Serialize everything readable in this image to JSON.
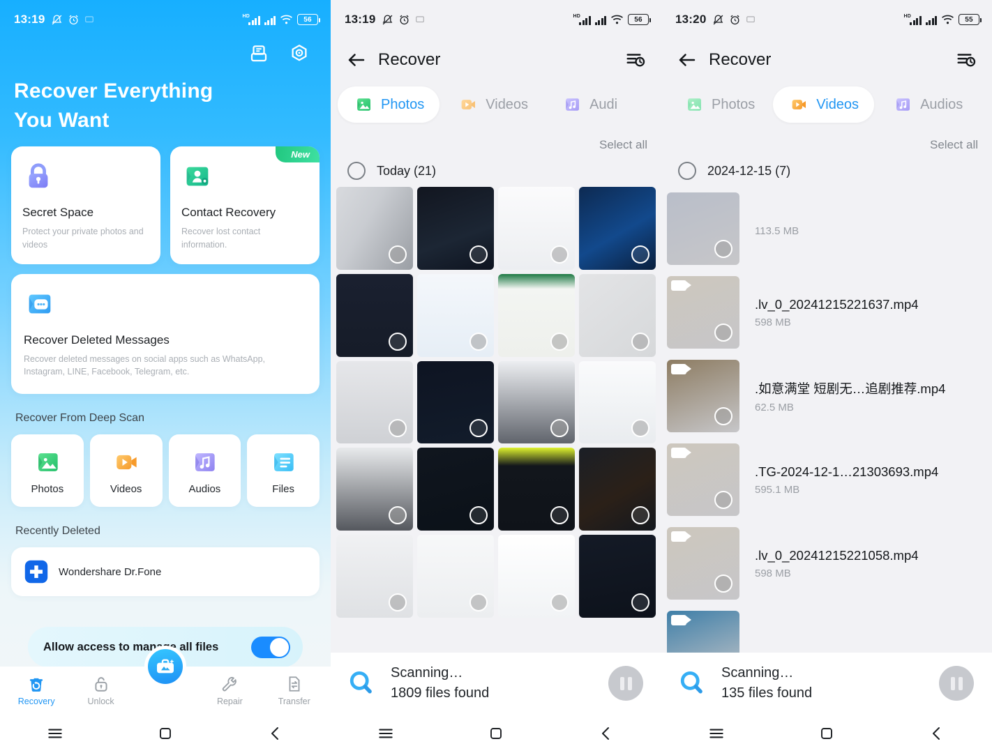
{
  "panel1": {
    "status": {
      "time": "13:19",
      "battery": "56",
      "hd_label": "HD",
      "icons": [
        "mute-icon",
        "alarm-icon",
        "cast-icon"
      ]
    },
    "header_icons": [
      {
        "name": "archive-icon"
      },
      {
        "name": "settings-hex-icon"
      }
    ],
    "hero": {
      "line1": "Recover Everything",
      "line2": "You Want"
    },
    "cards": [
      {
        "icon": "lock-icon",
        "title": "Secret Space",
        "desc": "Protect your private photos and videos",
        "badge": ""
      },
      {
        "icon": "contact-icon",
        "title": "Contact Recovery",
        "desc": "Recover lost contact information.",
        "badge": "New"
      }
    ],
    "wide_card": {
      "icon": "message-bubble-icon",
      "title": "Recover Deleted Messages",
      "desc": "Recover deleted messages on social apps such as WhatsApp, Instagram, LINE, Facebook, Telegram, etc."
    },
    "deep_scan": {
      "section_title": "Recover From Deep Scan",
      "tiles": [
        {
          "label": "Photos",
          "icon": "photos-icon"
        },
        {
          "label": "Videos",
          "icon": "videos-icon"
        },
        {
          "label": "Audios",
          "icon": "audios-icon"
        },
        {
          "label": "Files",
          "icon": "files-icon"
        }
      ]
    },
    "recently_deleted": {
      "section_title": "Recently Deleted",
      "app_name": "Wondershare Dr.Fone",
      "app_icon": "drfone-plus-icon"
    },
    "allow_banner": {
      "text": "Allow access to manage all files",
      "toggle_on": true
    },
    "tabbar": [
      {
        "label": "Recovery",
        "icon": "trash-restore-icon",
        "active": true
      },
      {
        "label": "Unlock",
        "icon": "unlock-icon",
        "active": false
      },
      {
        "label": "Repair",
        "icon": "wrench-icon",
        "active": false
      },
      {
        "label": "Transfer",
        "icon": "transfer-icon",
        "active": false
      }
    ],
    "fab": {
      "name": "toolbox-fab",
      "icon": "toolbox-icon"
    },
    "navbar": [
      "menu-icon",
      "home-square-icon",
      "back-chevron-icon"
    ]
  },
  "panel2": {
    "status": {
      "time": "13:19",
      "battery": "56",
      "hd_label": "HD"
    },
    "appbar": {
      "back_icon": "back-arrow-icon",
      "title": "Recover",
      "history_icon": "history-list-icon"
    },
    "tabs": [
      {
        "label": "Photos",
        "icon": "photos-icon",
        "active": true
      },
      {
        "label": "Videos",
        "icon": "videos-icon",
        "active": false
      },
      {
        "label": "Audi",
        "icon": "audios-icon",
        "active": false
      }
    ],
    "select_all": "Select all",
    "group": {
      "label": "Today (21)",
      "checked": false
    },
    "grid_count": 20,
    "scan": {
      "status": "Scanning…",
      "found": "1809 files found",
      "pause_icon": "pause-icon",
      "search_icon": "search-icon"
    },
    "navbar": [
      "menu-icon",
      "home-square-icon",
      "back-chevron-icon"
    ]
  },
  "panel3": {
    "status": {
      "time": "13:20",
      "battery": "55",
      "hd_label": "HD"
    },
    "appbar": {
      "back_icon": "back-arrow-icon",
      "title": "Recover",
      "history_icon": "history-list-icon"
    },
    "tabs": [
      {
        "label": "Photos",
        "icon": "photos-icon",
        "active": false
      },
      {
        "label": "Videos",
        "icon": "videos-icon",
        "active": true
      },
      {
        "label": "Audios",
        "icon": "audios-icon",
        "active": false
      }
    ],
    "select_all": "Select all",
    "group": {
      "label": "2024-12-15 (7)",
      "checked": false
    },
    "files": [
      {
        "name": "",
        "size": "113.5 MB",
        "thumb": "#b9bec9"
      },
      {
        "name": ".lv_0_20241215221637.mp4",
        "size": "598 MB",
        "thumb": "#cdc7bd"
      },
      {
        "name": ".如意满堂 短剧无…追剧推荐.mp4",
        "size": "62.5 MB",
        "thumb": "#8d7c62"
      },
      {
        "name": ".TG-2024-12-1…21303693.mp4",
        "size": "595.1 MB",
        "thumb": "#cdc7bd"
      },
      {
        "name": ".lv_0_20241215221058.mp4",
        "size": "598 MB",
        "thumb": "#cdc7bd"
      },
      {
        "name": "",
        "size": "",
        "thumb": "#3f7fa8"
      }
    ],
    "scan": {
      "status": "Scanning…",
      "found": "135 files found",
      "pause_icon": "pause-icon",
      "search_icon": "search-icon"
    },
    "navbar": [
      "menu-icon",
      "home-square-icon",
      "back-chevron-icon"
    ]
  },
  "colors": {
    "brand_blue": "#2196F3",
    "hero_top": "#17AFFF",
    "page_bg": "#F2F2F5",
    "badge_green": "#21C77F",
    "toggle_on": "#1A8CFF"
  }
}
